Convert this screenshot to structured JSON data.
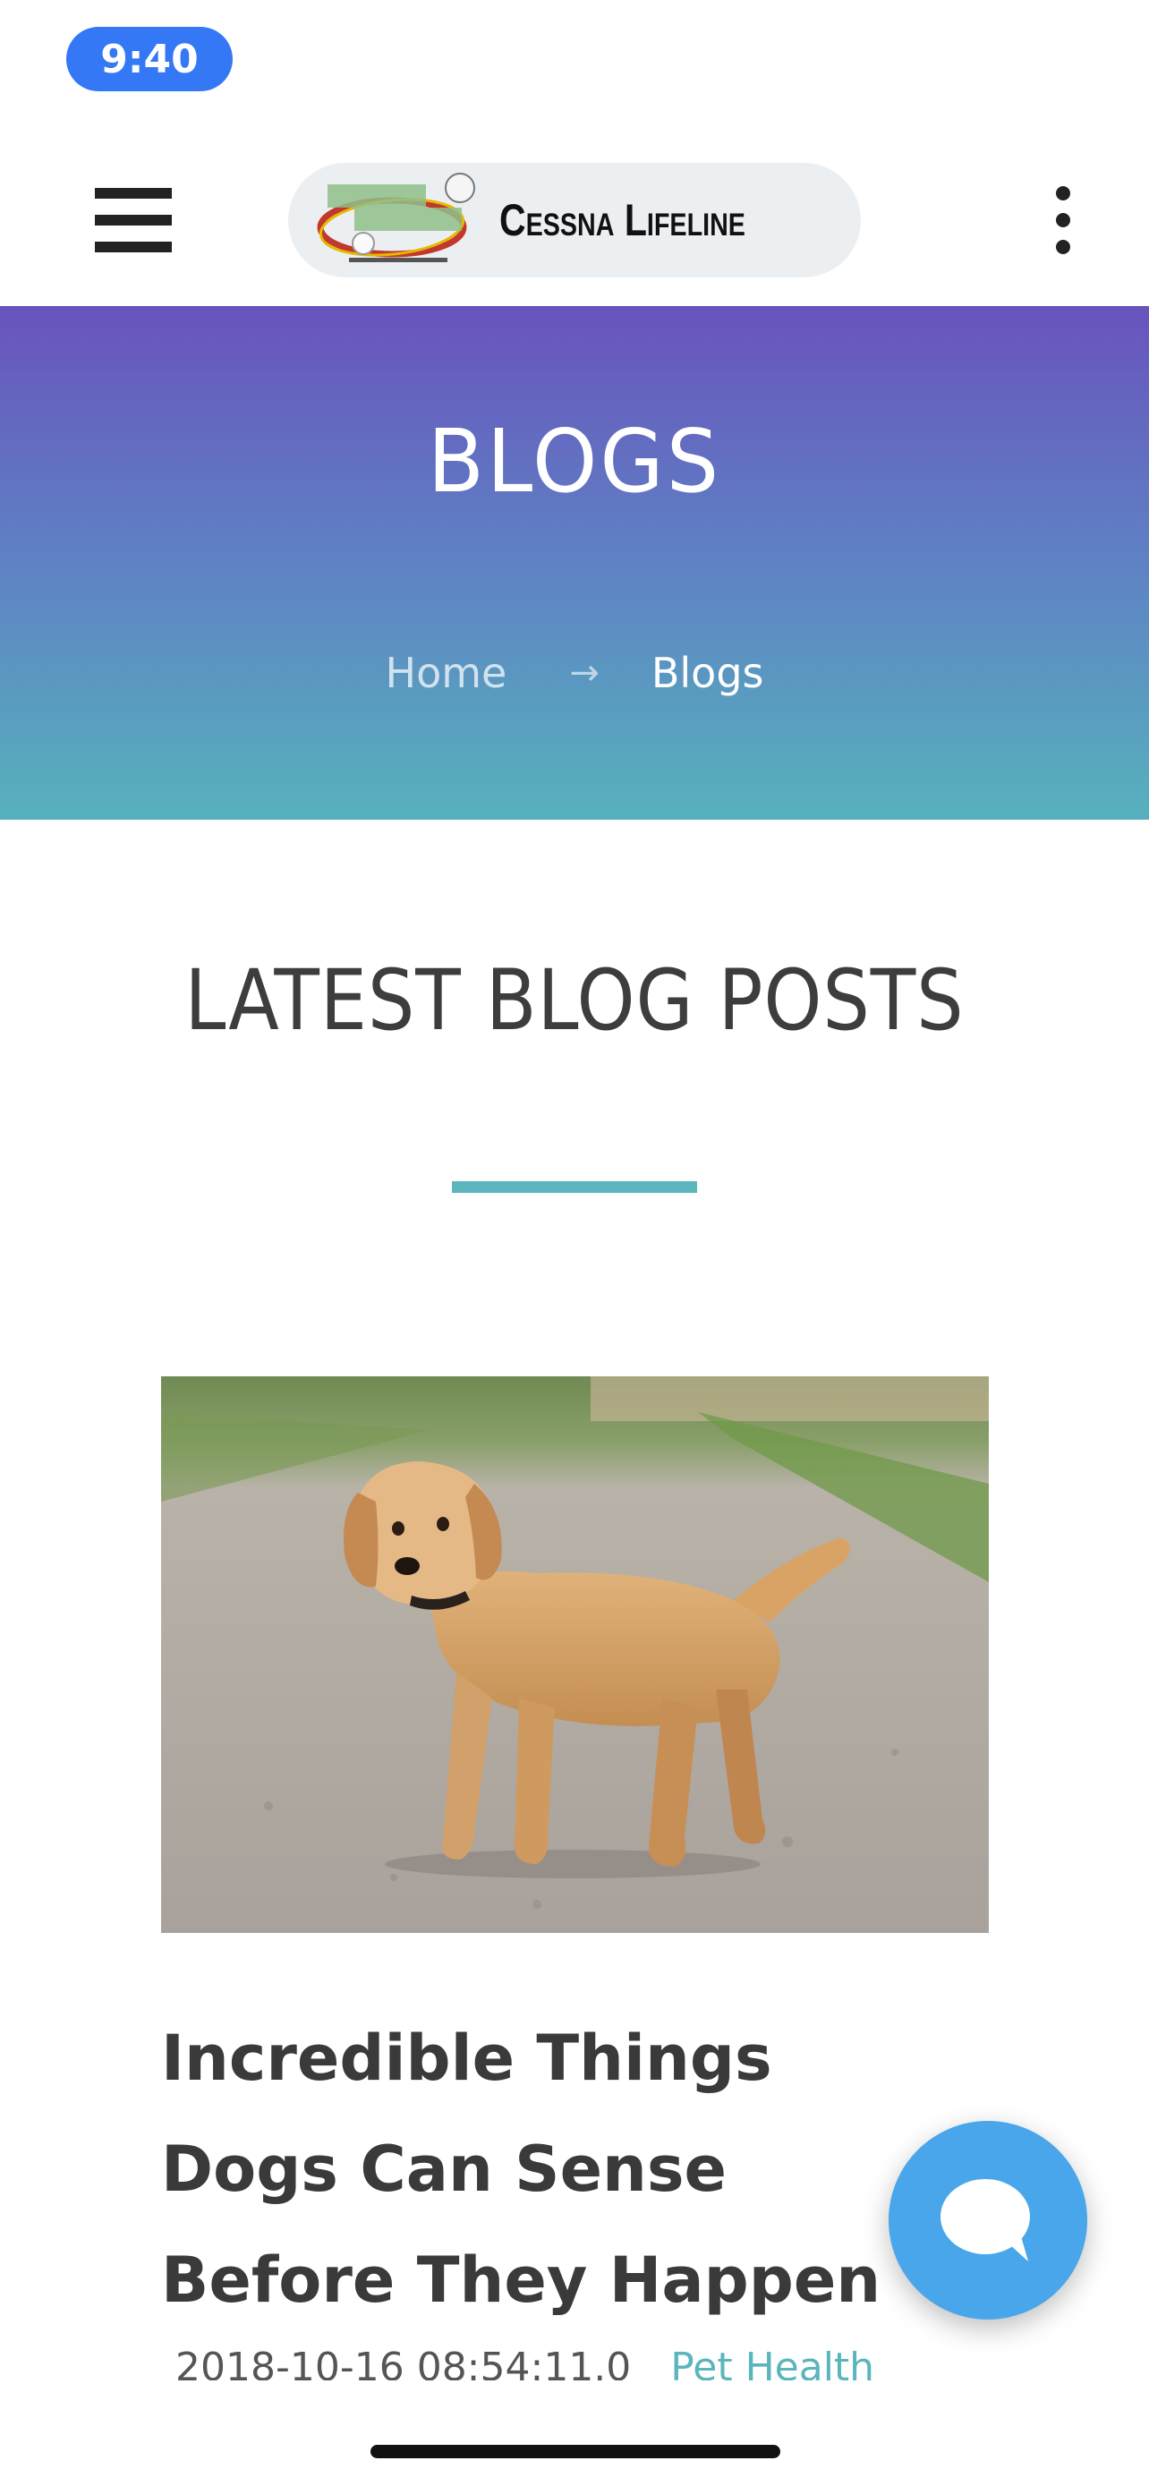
{
  "status_bar": {
    "time": "9:40"
  },
  "header": {
    "logo_text": "Cessna Lifeline",
    "menu_icon": "hamburger-menu-icon",
    "more_icon": "more-vertical-icon"
  },
  "hero": {
    "title": "BLOGS",
    "breadcrumb": {
      "home": "Home",
      "separator_icon": "arrow-right-icon",
      "current": "Blogs"
    }
  },
  "section": {
    "title": "LATEST BLOG POSTS"
  },
  "posts": [
    {
      "image": "golden-retriever-puppy-photo",
      "title": "Incredible Things Dogs Can Sense Before They Happen",
      "date": "2018-10-16 08:54:11.0",
      "category": "Pet Health"
    }
  ],
  "chat": {
    "icon": "chat-bubble-icon"
  },
  "colors": {
    "time_pill": "#3478f6",
    "hero_gradient_top": "#6953bd",
    "hero_gradient_bottom": "#57b1bd",
    "accent": "#5bb5bd",
    "chat_button": "#4aa6ea"
  }
}
